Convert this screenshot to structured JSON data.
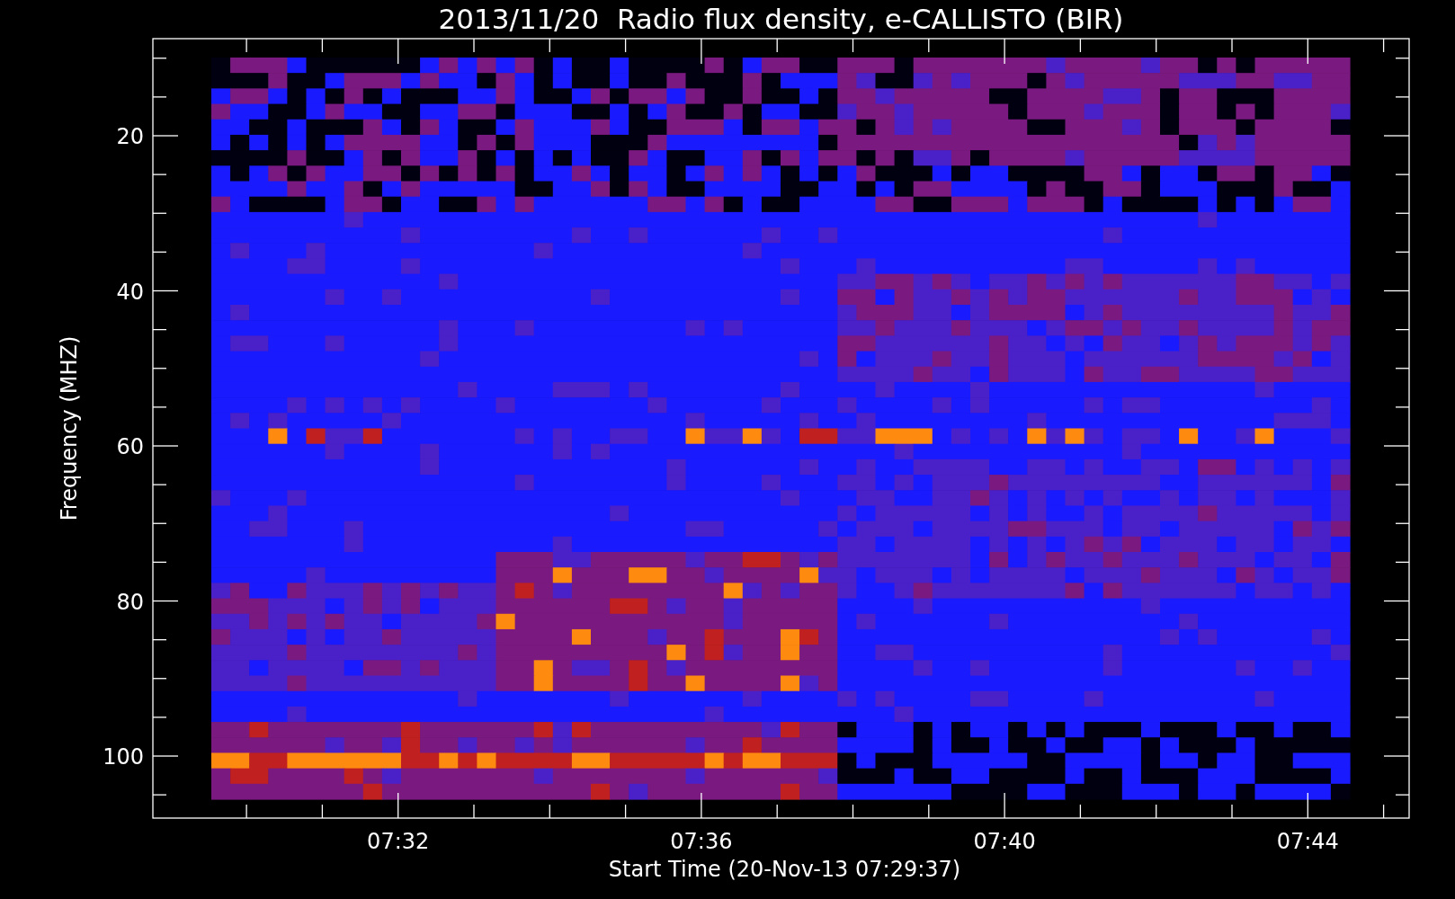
{
  "title": "2013/11/20  Radio flux density, e-CALLISTO (BIR)",
  "y_axis": {
    "label": "Frequency (MHZ)",
    "ticks": [
      "20",
      "40",
      "60",
      "80",
      "100"
    ]
  },
  "x_axis": {
    "label": "Start Time (20-Nov-13 07:29:37)",
    "ticks": [
      "07:32",
      "07:36",
      "07:40",
      "07:44"
    ]
  }
}
